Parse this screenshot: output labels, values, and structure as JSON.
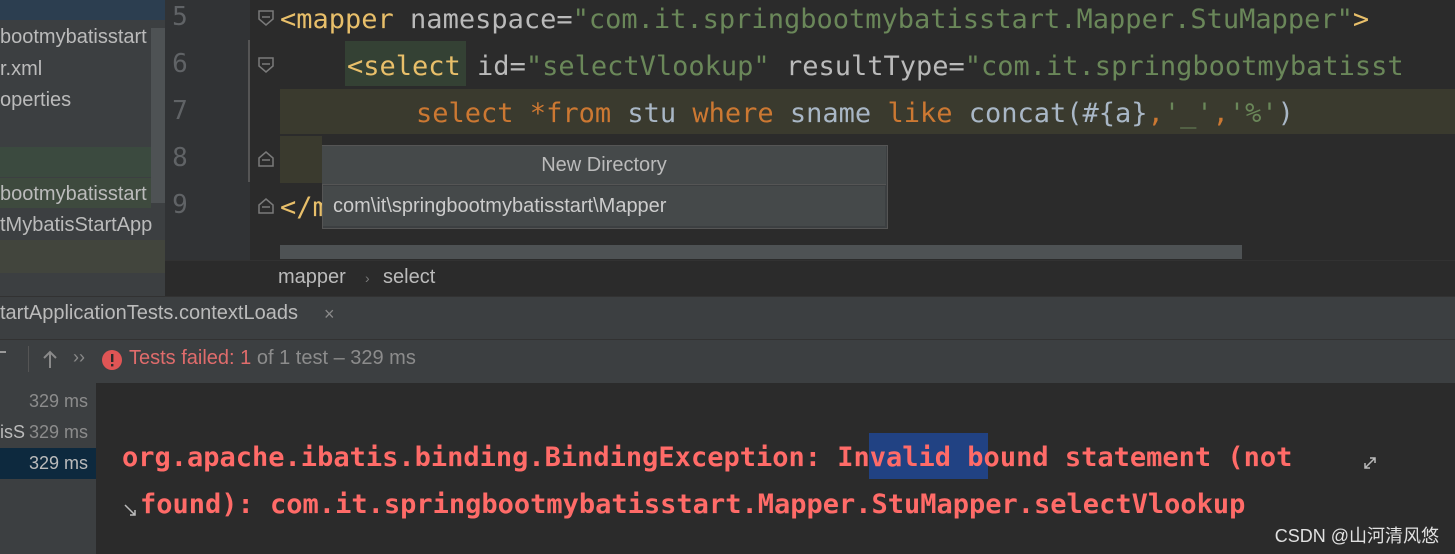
{
  "project_tree": {
    "items": [
      "bootmybatisstart",
      "r.xml",
      "operties",
      "bootmybatisstart",
      "tMybatisStartApp"
    ]
  },
  "line_numbers": [
    "5",
    "6",
    "7",
    "8",
    "9"
  ],
  "code": {
    "line5": {
      "tag_open": "<mapper",
      "attr": " namespace",
      "eq": "=",
      "value": "\"com.it.springbootmybatisstart.Mapper.StuMapper\"",
      "close": ">"
    },
    "line6": {
      "tag_open": "<select",
      "attr1": " id",
      "eq1": "=",
      "value1": "\"selectVlookup\"",
      "attr2": " resultType",
      "eq2": "=",
      "value2": "\"com.it.springbootmybatisst"
    },
    "line7": {
      "kw_select": "select ",
      "star": "*",
      "kw_from": "from",
      "table": " stu ",
      "kw_where": "where",
      "col": " sname ",
      "kw_like": "like",
      "fn": " concat(#{a}",
      "comma1": ",",
      "s1": "'_'",
      "comma2": ",",
      "s2": "'%'",
      "paren": ")"
    },
    "line9": {
      "tag": "</m"
    }
  },
  "popup": {
    "title": "New Directory",
    "value": "com\\it\\springbootmybatisstart\\Mapper"
  },
  "breadcrumb": [
    "mapper",
    "select"
  ],
  "run_panel": {
    "tab_label": "tartApplicationTests.contextLoads",
    "close": "×",
    "status_prefix": "Tests failed: ",
    "failed_count": "1",
    "status_suffix": " of 1 test – 329 ms",
    "tests": [
      {
        "label": "",
        "time": "329 ms"
      },
      {
        "label": "isS",
        "time": "329 ms"
      },
      {
        "label": "",
        "time": "329 ms"
      }
    ]
  },
  "console": {
    "line1_a": "org.apache.ibatis.binding.BindingException: ",
    "line1_hl": "Invalid",
    "line1_b": " bound statement (not",
    "line2": "found): com.it.springbootmybatisstart.Mapper.StuMapper.selectVlookup"
  },
  "watermark": "CSDN @山河清风悠",
  "colors": {
    "error": "#ff6b68",
    "tag": "#e8bf6a",
    "string": "#6a8759",
    "keyword": "#cc7832",
    "selection": "#214283"
  }
}
